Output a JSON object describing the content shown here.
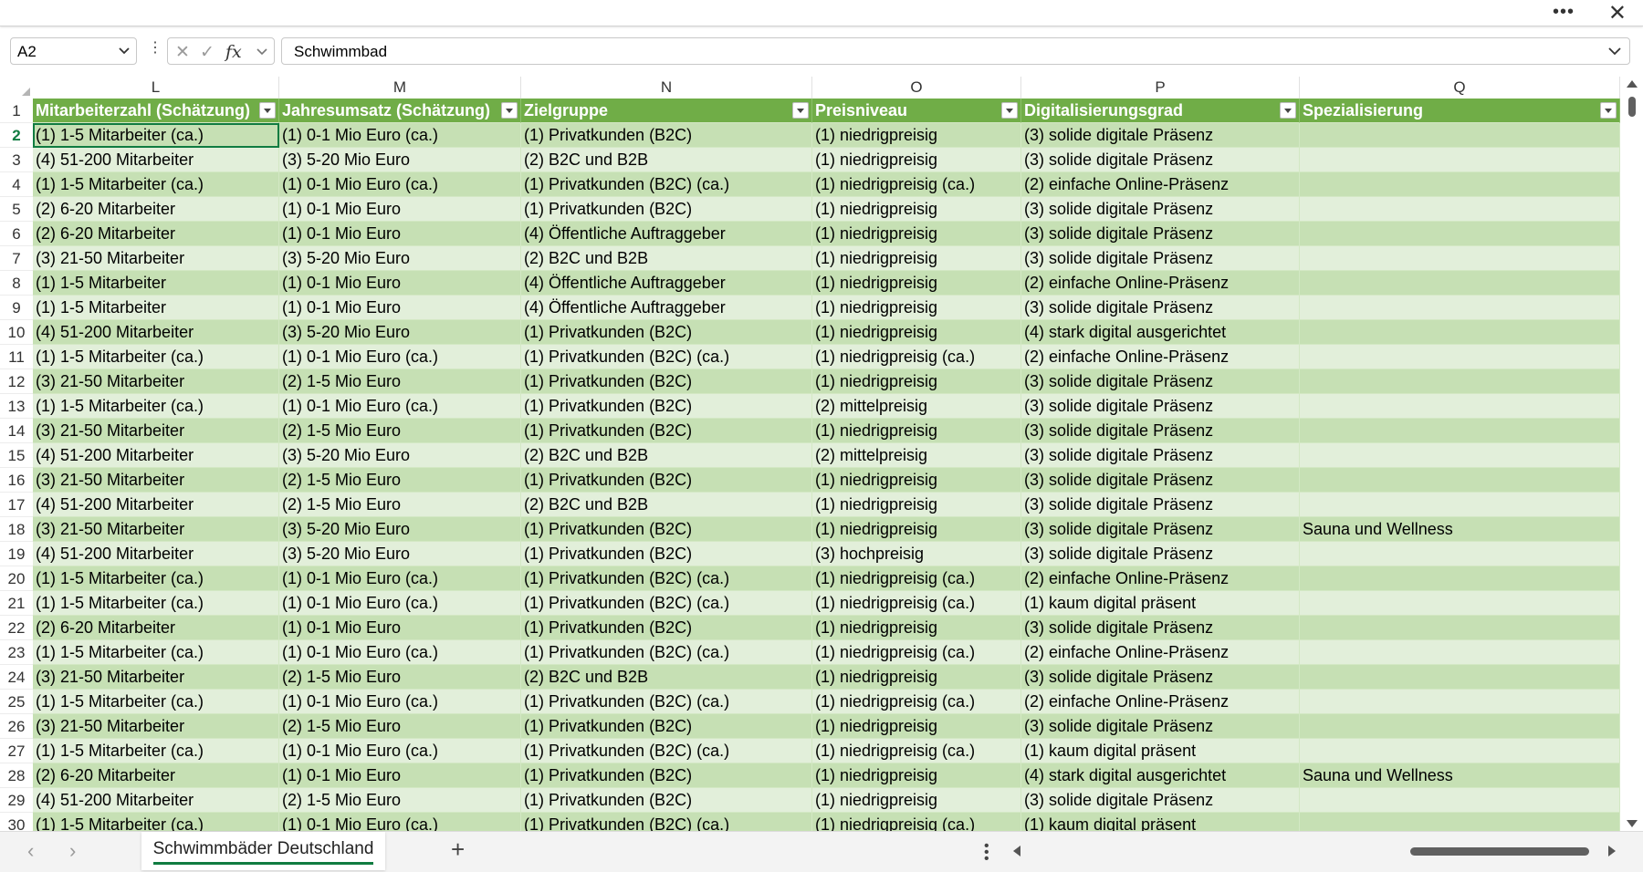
{
  "window": {
    "more_icon": "more-horizontal-icon",
    "close_icon": "close-icon"
  },
  "formula_bar": {
    "name_box": "A2",
    "formula": "Schwimmbad"
  },
  "columns": [
    "L",
    "M",
    "N",
    "O",
    "P",
    "Q"
  ],
  "headers": [
    "Mitarbeiterzahl (Schätzung)",
    "Jahresumsatz (Schätzung)",
    "Zielgruppe",
    "Preisniveau",
    "Digitalisierungsgrad",
    "Spezialisierung"
  ],
  "rows": [
    {
      "n": "2",
      "c": [
        "(1) 1-5 Mitarbeiter (ca.)",
        "(1) 0-1 Mio Euro (ca.)",
        "(1) Privatkunden (B2C)",
        "(1) niedrigpreisig",
        "(3) solide digitale Präsenz",
        ""
      ]
    },
    {
      "n": "3",
      "c": [
        "(4) 51-200 Mitarbeiter",
        "(3) 5-20 Mio Euro",
        "(2) B2C und B2B",
        "(1) niedrigpreisig",
        "(3) solide digitale Präsenz",
        ""
      ]
    },
    {
      "n": "4",
      "c": [
        "(1) 1-5 Mitarbeiter (ca.)",
        "(1) 0-1 Mio Euro (ca.)",
        "(1) Privatkunden (B2C) (ca.)",
        "(1) niedrigpreisig (ca.)",
        "(2) einfache Online-Präsenz",
        ""
      ]
    },
    {
      "n": "5",
      "c": [
        "(2) 6-20 Mitarbeiter",
        "(1) 0-1 Mio Euro",
        "(1) Privatkunden (B2C)",
        "(1) niedrigpreisig",
        "(3) solide digitale Präsenz",
        ""
      ]
    },
    {
      "n": "6",
      "c": [
        "(2) 6-20 Mitarbeiter",
        "(1) 0-1 Mio Euro",
        "(4) Öffentliche Auftraggeber",
        "(1) niedrigpreisig",
        "(3) solide digitale Präsenz",
        ""
      ]
    },
    {
      "n": "7",
      "c": [
        "(3) 21-50 Mitarbeiter",
        "(3) 5-20 Mio Euro",
        "(2) B2C und B2B",
        "(1) niedrigpreisig",
        "(3) solide digitale Präsenz",
        ""
      ]
    },
    {
      "n": "8",
      "c": [
        "(1) 1-5 Mitarbeiter",
        "(1) 0-1 Mio Euro",
        "(4) Öffentliche Auftraggeber",
        "(1) niedrigpreisig",
        "(2) einfache Online-Präsenz",
        ""
      ]
    },
    {
      "n": "9",
      "c": [
        "(1) 1-5 Mitarbeiter",
        "(1) 0-1 Mio Euro",
        "(4) Öffentliche Auftraggeber",
        "(1) niedrigpreisig",
        "(3) solide digitale Präsenz",
        ""
      ]
    },
    {
      "n": "10",
      "c": [
        "(4) 51-200 Mitarbeiter",
        "(3) 5-20 Mio Euro",
        "(1) Privatkunden (B2C)",
        "(1) niedrigpreisig",
        "(4) stark digital ausgerichtet",
        ""
      ]
    },
    {
      "n": "11",
      "c": [
        "(1) 1-5 Mitarbeiter (ca.)",
        "(1) 0-1 Mio Euro (ca.)",
        "(1) Privatkunden (B2C) (ca.)",
        "(1) niedrigpreisig (ca.)",
        "(2) einfache Online-Präsenz",
        ""
      ]
    },
    {
      "n": "12",
      "c": [
        "(3) 21-50 Mitarbeiter",
        "(2) 1-5 Mio Euro",
        "(1) Privatkunden (B2C)",
        "(1) niedrigpreisig",
        "(3) solide digitale Präsenz",
        ""
      ]
    },
    {
      "n": "13",
      "c": [
        "(1) 1-5 Mitarbeiter (ca.)",
        "(1) 0-1 Mio Euro (ca.)",
        "(1) Privatkunden (B2C)",
        "(2) mittelpreisig",
        "(3) solide digitale Präsenz",
        ""
      ]
    },
    {
      "n": "14",
      "c": [
        "(3) 21-50 Mitarbeiter",
        "(2) 1-5 Mio Euro",
        "(1) Privatkunden (B2C)",
        "(1) niedrigpreisig",
        "(3) solide digitale Präsenz",
        ""
      ]
    },
    {
      "n": "15",
      "c": [
        "(4) 51-200 Mitarbeiter",
        "(3) 5-20 Mio Euro",
        "(2) B2C und B2B",
        "(2) mittelpreisig",
        "(3) solide digitale Präsenz",
        ""
      ]
    },
    {
      "n": "16",
      "c": [
        "(3) 21-50 Mitarbeiter",
        "(2) 1-5 Mio Euro",
        "(1) Privatkunden (B2C)",
        "(1) niedrigpreisig",
        "(3) solide digitale Präsenz",
        ""
      ]
    },
    {
      "n": "17",
      "c": [
        "(4) 51-200 Mitarbeiter",
        "(2) 1-5 Mio Euro",
        "(2) B2C und B2B",
        "(1) niedrigpreisig",
        "(3) solide digitale Präsenz",
        ""
      ]
    },
    {
      "n": "18",
      "c": [
        "(3) 21-50 Mitarbeiter",
        "(3) 5-20 Mio Euro",
        "(1) Privatkunden (B2C)",
        "(1) niedrigpreisig",
        "(3) solide digitale Präsenz",
        "Sauna und Wellness"
      ]
    },
    {
      "n": "19",
      "c": [
        "(4) 51-200 Mitarbeiter",
        "(3) 5-20 Mio Euro",
        "(1) Privatkunden (B2C)",
        "(3) hochpreisig",
        "(3) solide digitale Präsenz",
        ""
      ]
    },
    {
      "n": "20",
      "c": [
        "(1) 1-5 Mitarbeiter (ca.)",
        "(1) 0-1 Mio Euro (ca.)",
        "(1) Privatkunden (B2C) (ca.)",
        "(1) niedrigpreisig (ca.)",
        "(2) einfache Online-Präsenz",
        ""
      ]
    },
    {
      "n": "21",
      "c": [
        "(1) 1-5 Mitarbeiter (ca.)",
        "(1) 0-1 Mio Euro (ca.)",
        "(1) Privatkunden (B2C) (ca.)",
        "(1) niedrigpreisig (ca.)",
        "(1) kaum digital präsent",
        ""
      ]
    },
    {
      "n": "22",
      "c": [
        "(2) 6-20 Mitarbeiter",
        "(1) 0-1 Mio Euro",
        "(1) Privatkunden (B2C)",
        "(1) niedrigpreisig",
        "(3) solide digitale Präsenz",
        ""
      ]
    },
    {
      "n": "23",
      "c": [
        "(1) 1-5 Mitarbeiter (ca.)",
        "(1) 0-1 Mio Euro (ca.)",
        "(1) Privatkunden (B2C) (ca.)",
        "(1) niedrigpreisig (ca.)",
        "(2) einfache Online-Präsenz",
        ""
      ]
    },
    {
      "n": "24",
      "c": [
        "(3) 21-50 Mitarbeiter",
        "(2) 1-5 Mio Euro",
        "(2) B2C und B2B",
        "(1) niedrigpreisig",
        "(3) solide digitale Präsenz",
        ""
      ]
    },
    {
      "n": "25",
      "c": [
        "(1) 1-5 Mitarbeiter (ca.)",
        "(1) 0-1 Mio Euro (ca.)",
        "(1) Privatkunden (B2C) (ca.)",
        "(1) niedrigpreisig (ca.)",
        "(2) einfache Online-Präsenz",
        ""
      ]
    },
    {
      "n": "26",
      "c": [
        "(3) 21-50 Mitarbeiter",
        "(2) 1-5 Mio Euro",
        "(1) Privatkunden (B2C)",
        "(1) niedrigpreisig",
        "(3) solide digitale Präsenz",
        ""
      ]
    },
    {
      "n": "27",
      "c": [
        "(1) 1-5 Mitarbeiter (ca.)",
        "(1) 0-1 Mio Euro (ca.)",
        "(1) Privatkunden (B2C) (ca.)",
        "(1) niedrigpreisig (ca.)",
        "(1) kaum digital präsent",
        ""
      ]
    },
    {
      "n": "28",
      "c": [
        "(2) 6-20 Mitarbeiter",
        "(1) 0-1 Mio Euro",
        "(1) Privatkunden (B2C)",
        "(1) niedrigpreisig",
        "(4) stark digital ausgerichtet",
        "Sauna und Wellness"
      ]
    },
    {
      "n": "29",
      "c": [
        "(4) 51-200 Mitarbeiter",
        "(2) 1-5 Mio Euro",
        "(1) Privatkunden (B2C)",
        "(1) niedrigpreisig",
        "(3) solide digitale Präsenz",
        ""
      ]
    },
    {
      "n": "30",
      "c": [
        "(1) 1-5 Mitarbeiter (ca.)",
        "(1) 0-1 Mio Euro (ca.)",
        "(1) Privatkunden (B2C) (ca.)",
        "(1) niedrigpreisig (ca.)",
        "(1) kaum digital präsent",
        ""
      ]
    }
  ],
  "sheet_tab": "Schwimmbäder Deutschland",
  "colors": {
    "header_fill": "#70ad47",
    "band_dark": "#c6e0b4",
    "band_light": "#e2efda",
    "accent": "#107c41"
  }
}
